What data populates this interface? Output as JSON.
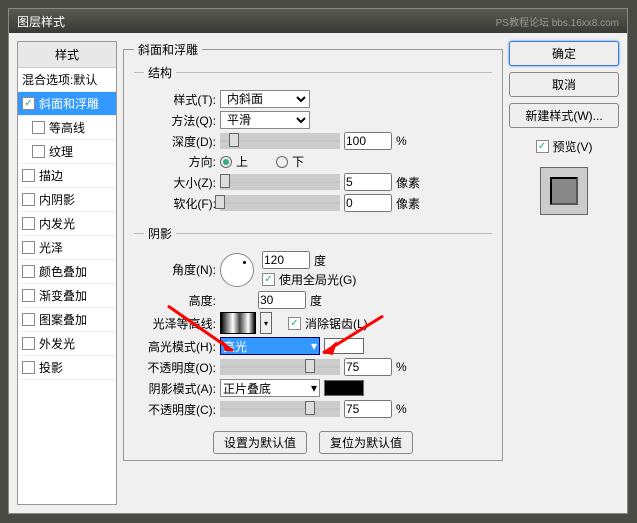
{
  "title": "图层样式",
  "watermark": "PS教程论坛\nbbs.16xx8.com",
  "styles_panel": {
    "header": "样式",
    "items": [
      {
        "label": "混合选项:默认",
        "checked": null,
        "selected": false,
        "child": false
      },
      {
        "label": "斜面和浮雕",
        "checked": true,
        "selected": true,
        "child": false
      },
      {
        "label": "等高线",
        "checked": false,
        "selected": false,
        "child": true
      },
      {
        "label": "纹理",
        "checked": false,
        "selected": false,
        "child": true
      },
      {
        "label": "描边",
        "checked": false,
        "selected": false,
        "child": false
      },
      {
        "label": "内阴影",
        "checked": false,
        "selected": false,
        "child": false
      },
      {
        "label": "内发光",
        "checked": false,
        "selected": false,
        "child": false
      },
      {
        "label": "光泽",
        "checked": false,
        "selected": false,
        "child": false
      },
      {
        "label": "颜色叠加",
        "checked": false,
        "selected": false,
        "child": false
      },
      {
        "label": "渐变叠加",
        "checked": false,
        "selected": false,
        "child": false
      },
      {
        "label": "图案叠加",
        "checked": false,
        "selected": false,
        "child": false
      },
      {
        "label": "外发光",
        "checked": false,
        "selected": false,
        "child": false
      },
      {
        "label": "投影",
        "checked": false,
        "selected": false,
        "child": false
      }
    ]
  },
  "bevel": {
    "group_title": "斜面和浮雕",
    "structure_title": "结构",
    "style_label": "样式(T):",
    "style_value": "内斜面",
    "technique_label": "方法(Q):",
    "technique_value": "平滑",
    "depth_label": "深度(D):",
    "depth_value": "100",
    "depth_unit": "%",
    "direction_label": "方向:",
    "dir_up": "上",
    "dir_down": "下",
    "size_label": "大小(Z):",
    "size_value": "5",
    "size_unit": "像素",
    "soften_label": "软化(F):",
    "soften_value": "0",
    "soften_unit": "像素"
  },
  "shading": {
    "title": "阴影",
    "angle_label": "角度(N):",
    "angle_value": "120",
    "angle_unit": "度",
    "global_label": "使用全局光(G)",
    "altitude_label": "高度:",
    "altitude_value": "30",
    "altitude_unit": "度",
    "gloss_label": "光泽等高线:",
    "antialias_label": "消除锯齿(L)",
    "hmode_label": "高光模式(H):",
    "hmode_value": "亮光",
    "hopacity_label": "不透明度(O):",
    "hopacity_value": "75",
    "hopacity_unit": "%",
    "smode_label": "阴影模式(A):",
    "smode_value": "正片叠底",
    "sopacity_label": "不透明度(C):",
    "sopacity_value": "75",
    "sopacity_unit": "%"
  },
  "buttons": {
    "default": "设置为默认值",
    "reset": "复位为默认值",
    "ok": "确定",
    "cancel": "取消",
    "new_style": "新建样式(W)...",
    "preview": "预览(V)"
  }
}
